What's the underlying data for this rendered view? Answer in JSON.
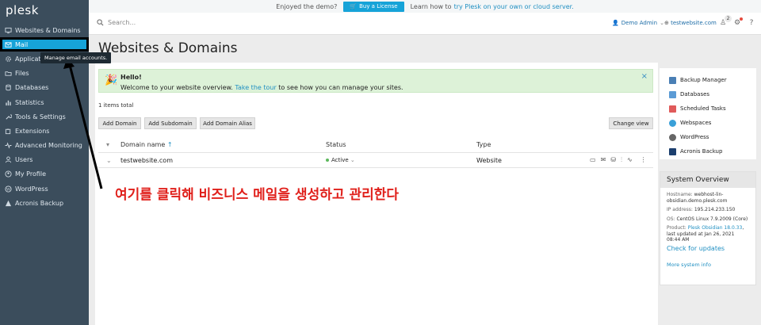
{
  "app": {
    "logo": "plesk"
  },
  "sidebar": {
    "items": [
      {
        "label": "Websites & Domains",
        "icon": "monitor-icon"
      },
      {
        "label": "Mail",
        "icon": "mail-icon"
      },
      {
        "label": "Applications",
        "icon": "gear-icon"
      },
      {
        "label": "Files",
        "icon": "folder-icon"
      },
      {
        "label": "Databases",
        "icon": "database-icon"
      },
      {
        "label": "Statistics",
        "icon": "bar-chart-icon"
      },
      {
        "label": "Tools & Settings",
        "icon": "wrench-icon"
      },
      {
        "label": "Extensions",
        "icon": "puzzle-icon"
      },
      {
        "label": "Advanced Monitoring",
        "icon": "pulse-icon"
      },
      {
        "label": "Users",
        "icon": "user-icon"
      },
      {
        "label": "My Profile",
        "icon": "profile-icon"
      },
      {
        "label": "WordPress",
        "icon": "wordpress-icon"
      },
      {
        "label": "Acronis Backup",
        "icon": "acronis-icon"
      }
    ],
    "tooltip": "Manage email accounts.",
    "collapse": "‹"
  },
  "promo": {
    "text": "Enjoyed the demo?",
    "button": "Buy a License",
    "text2": "Learn how to",
    "link": "try Plesk on your own or cloud server."
  },
  "topbar": {
    "search_placeholder": "Search...",
    "user": "Demo Admin",
    "site": "testwebsite.com",
    "notification_count": "2"
  },
  "page": {
    "title": "Websites & Domains"
  },
  "hello": {
    "title": "Hello!",
    "text_before": "Welcome to your website overview.",
    "link": "Take the tour",
    "text_after": "to see how you can manage your sites.",
    "close": "×"
  },
  "list": {
    "total": "1 items total",
    "buttons": {
      "add_domain": "Add Domain",
      "add_subdomain": "Add Subdomain",
      "add_alias": "Add Domain Alias",
      "change_view": "Change view"
    },
    "columns": {
      "domain": "Domain name",
      "status": "Status",
      "type": "Type"
    },
    "rows": [
      {
        "domain": "testwebsite.com",
        "status": "Active",
        "type": "Website"
      }
    ]
  },
  "annotation": {
    "text": "여기를 클릭해 비즈니스 메일을 생성하고 관리한다",
    "color": "#e0201b"
  },
  "quick_links": [
    {
      "label": "Backup Manager",
      "color": "#4a7fb5"
    },
    {
      "label": "Databases",
      "color": "#5b9bd5"
    },
    {
      "label": "Scheduled Tasks",
      "color": "#e05a5a"
    },
    {
      "label": "Webspaces",
      "color": "#3aa0d8"
    },
    {
      "label": "WordPress",
      "color": "#666666"
    },
    {
      "label": "Acronis Backup",
      "color": "#1c3f6e"
    }
  ],
  "system_overview": {
    "title": "System Overview",
    "hostname_label": "Hostname:",
    "hostname": "webhost-lin-obsidian.demo.plesk.com",
    "ip_label": "IP address:",
    "ip": "195.214.233.150",
    "os_label": "OS:",
    "os": "CentOS Linux 7.9.2009 (Core)",
    "product_label": "Product:",
    "product": "Plesk Obsidian 18.0.33",
    "updated": ", last updated at Jan 26, 2021 08:44 AM",
    "check_updates": "Check for updates",
    "more_info": "More system info"
  },
  "colors": {
    "accent": "#16a3d8",
    "sidebar": "#3b4d5c",
    "success": "#5cb85c"
  }
}
